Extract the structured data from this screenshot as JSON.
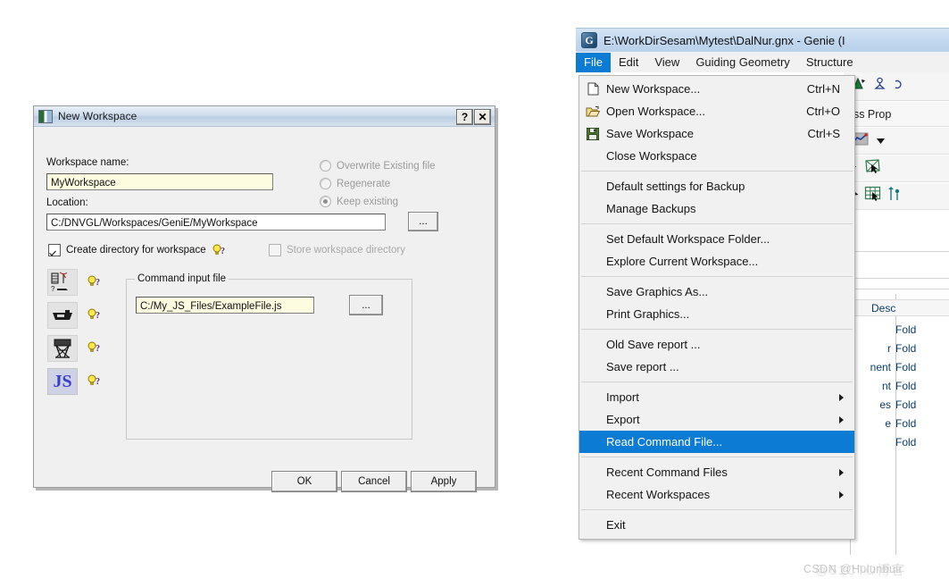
{
  "dialog": {
    "title": "New Workspace",
    "icon_name": "workspace-icon",
    "help_button": "?",
    "close_button": "✕",
    "workspace_name_label": "Workspace name:",
    "workspace_name_value": "MyWorkspace",
    "location_label": "Location:",
    "location_value": "C:/DNVGL/Workspaces/GeniE/MyWorkspace",
    "browse_location_label": "...",
    "create_directory_label": "Create directory for workspace",
    "create_directory_checked": true,
    "store_workspace_label": "Store workspace directory",
    "store_workspace_checked": false,
    "radios": [
      {
        "label": "Overwrite Existing file",
        "selected": false
      },
      {
        "label": "Regenerate",
        "selected": false
      },
      {
        "label": "Keep existing",
        "selected": true
      }
    ],
    "type_icons": [
      {
        "name": "general-structure-icon",
        "selected": false
      },
      {
        "name": "ship-hull-icon",
        "selected": false
      },
      {
        "name": "jacket-tower-icon",
        "selected": false
      },
      {
        "name": "javascript-icon",
        "label": "JS",
        "selected": true
      }
    ],
    "group_title": "Command input file",
    "command_file_value": "C:/My_JS_Files/ExampleFile.js",
    "browse_command_label": "...",
    "ok_label": "OK",
    "cancel_label": "Cancel",
    "apply_label": "Apply"
  },
  "genie": {
    "title": "E:\\WorkDirSesam\\Mytest\\DalNur.gnx - Genie (I",
    "app_icon_letter": "G",
    "menubar": [
      {
        "label": "File",
        "active": true
      },
      {
        "label": "Edit",
        "active": false
      },
      {
        "label": "View",
        "active": false
      },
      {
        "label": "Guiding Geometry",
        "active": false
      },
      {
        "label": "Structure",
        "active": false
      }
    ],
    "property_strip_text": "ess Prop",
    "tree_header": "Desc",
    "tree_rows": [
      {
        "name": "",
        "desc": "Fold"
      },
      {
        "name": "r",
        "desc": "Fold"
      },
      {
        "name": "nent",
        "desc": "Fold"
      },
      {
        "name": "nt",
        "desc": "Fold"
      },
      {
        "name": "es",
        "desc": "Fold"
      },
      {
        "name": "e",
        "desc": "Fold"
      },
      {
        "name": "",
        "desc": "Fold"
      }
    ]
  },
  "file_menu": [
    {
      "type": "item",
      "label": "New Workspace...",
      "mnemonic": "N",
      "accel": "Ctrl+N",
      "icon": "new-document-icon"
    },
    {
      "type": "item",
      "label": "Open Workspace...",
      "mnemonic": "O",
      "accel": "Ctrl+O",
      "icon": "open-folder-icon"
    },
    {
      "type": "item",
      "label": "Save Workspace",
      "mnemonic": "S",
      "accel": "Ctrl+S",
      "icon": "save-floppy-icon"
    },
    {
      "type": "item",
      "label": "Close Workspace",
      "mnemonic": "C",
      "accel": "",
      "icon": ""
    },
    {
      "type": "separator"
    },
    {
      "type": "item",
      "label": "Default settings for Backup",
      "mnemonic": "",
      "accel": "",
      "icon": ""
    },
    {
      "type": "item",
      "label": "Manage Backups",
      "mnemonic": "B",
      "accel": "",
      "icon": ""
    },
    {
      "type": "separator"
    },
    {
      "type": "item",
      "label": "Set Default Workspace Folder...",
      "mnemonic": "",
      "accel": "",
      "icon": ""
    },
    {
      "type": "item",
      "label": "Explore Current Workspace...",
      "mnemonic": "",
      "accel": "",
      "icon": ""
    },
    {
      "type": "separator"
    },
    {
      "type": "item",
      "label": "Save Graphics As...",
      "mnemonic": "G",
      "accel": "",
      "icon": ""
    },
    {
      "type": "item",
      "label": "Print Graphics...",
      "mnemonic": "P",
      "accel": "",
      "icon": ""
    },
    {
      "type": "separator"
    },
    {
      "type": "item",
      "label": "Old Save report ...",
      "mnemonic": "r",
      "accel": "",
      "icon": ""
    },
    {
      "type": "item",
      "label": "Save report ...",
      "mnemonic": "r",
      "accel": "",
      "icon": ""
    },
    {
      "type": "separator"
    },
    {
      "type": "item",
      "label": "Import",
      "mnemonic": "I",
      "accel": "",
      "icon": "",
      "submenu": true
    },
    {
      "type": "item",
      "label": "Export",
      "mnemonic": "E",
      "accel": "",
      "icon": "",
      "submenu": true
    },
    {
      "type": "item",
      "label": "Read Command File...",
      "mnemonic": "F",
      "accel": "",
      "icon": "",
      "highlight": true
    },
    {
      "type": "separator"
    },
    {
      "type": "item",
      "label": "Recent Command Files",
      "mnemonic": "m",
      "accel": "",
      "icon": "",
      "submenu": true
    },
    {
      "type": "item",
      "label": "Recent Workspaces",
      "mnemonic": "W",
      "accel": "",
      "icon": "",
      "submenu": true
    },
    {
      "type": "separator"
    },
    {
      "type": "item",
      "label": "Exit",
      "mnemonic": "x",
      "accel": "",
      "icon": ""
    }
  ],
  "watermark": {
    "text": "CSDN @Hulunbuir",
    "overlay": "@51CTO博客"
  },
  "colors": {
    "menu_highlight": "#0b7bd4",
    "dialog_face": "#f0f0f0",
    "field_yellow": "#fdfbe0",
    "disabled_text": "#9a9a9a"
  }
}
